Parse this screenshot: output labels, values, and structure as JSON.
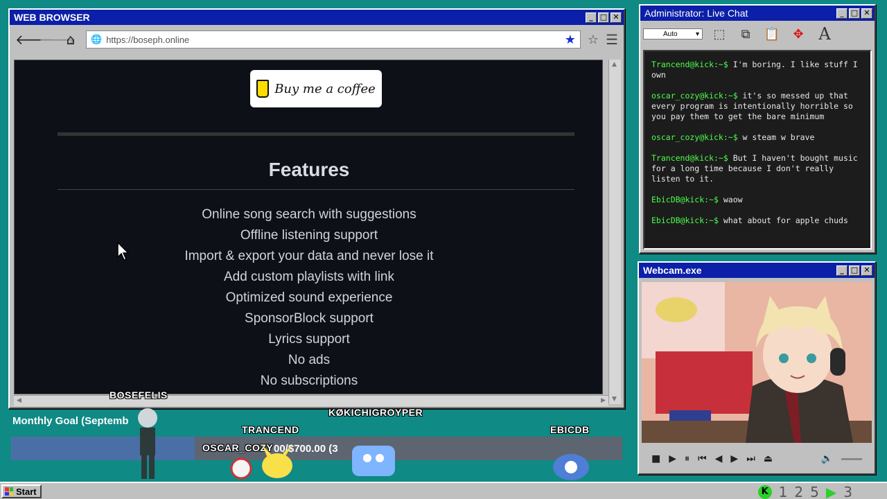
{
  "browser": {
    "title": "WEB BROWSER",
    "url": "https://boseph.online",
    "coffee_label": "Buy me a coffee",
    "features_heading": "Features",
    "features": [
      "Online song search with suggestions",
      "Offline listening support",
      "Import & export your data and never lose it",
      "Add custom playlists with link",
      "Optimized sound experience",
      "SponsorBlock support",
      "Lyrics support",
      "No ads",
      "No subscriptions"
    ]
  },
  "chat": {
    "title": "Administrator: Live Chat",
    "select_value": "Auto",
    "messages": [
      {
        "user": "Trancend@kick:~$",
        "text": " I'm boring. I like stuff I own"
      },
      {
        "user": "oscar_cozy@kick:~$",
        "text": " it's so messed up that every program is intentionally horrible so you pay them to get the bare minimum"
      },
      {
        "user": "oscar_cozy@kick:~$",
        "text": " w steam w brave"
      },
      {
        "user": "Trancend@kick:~$",
        "text": " But I haven't bought music for a long time because I don't really listen to it."
      },
      {
        "user": "EbicDB@kick:~$",
        "text": " waow"
      },
      {
        "user": "EbicDB@kick:~$",
        "text": " what about for apple chuds"
      }
    ]
  },
  "webcam": {
    "title": "Webcam.exe"
  },
  "overlay": {
    "goal_label": "Monthly Goal (Septemb",
    "goal_amount": "00/$700.00 (3",
    "goal_progress": 0.3,
    "nicks": {
      "bosefelis": "BOSEFELIS",
      "trancend": "TRANCEND",
      "koki": "KØKICHIGROYPER",
      "ebicdb": "EBICDB",
      "oscar": "OSCAR_COZY"
    }
  },
  "taskbar": {
    "start_label": "Start",
    "tray_k": "K",
    "tray_n1": "1",
    "tray_n2": "2",
    "tray_n5": "5",
    "tray_n3": "3"
  },
  "colors": {
    "title_blue": "#0b1fa8",
    "chat_user_green": "#4cff4c",
    "desktop": "#0f8a85"
  }
}
